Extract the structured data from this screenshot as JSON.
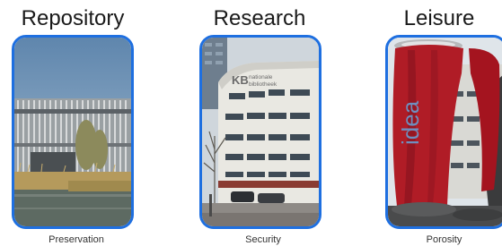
{
  "panels": [
    {
      "title": "Repository",
      "caption": "Preservation",
      "image": "modern-archive-building-with-reeds-and-pond"
    },
    {
      "title": "Research",
      "caption": "Security",
      "image": "national-library-building-street-view",
      "sign": [
        "KB",
        "nationale",
        "bibliotheek"
      ]
    },
    {
      "title": "Leisure",
      "caption": "Porosity",
      "image": "red-cloth-covered-can-over-building",
      "logo_text": "idea"
    }
  ],
  "colors": {
    "card_border": "#1e6fe0"
  }
}
